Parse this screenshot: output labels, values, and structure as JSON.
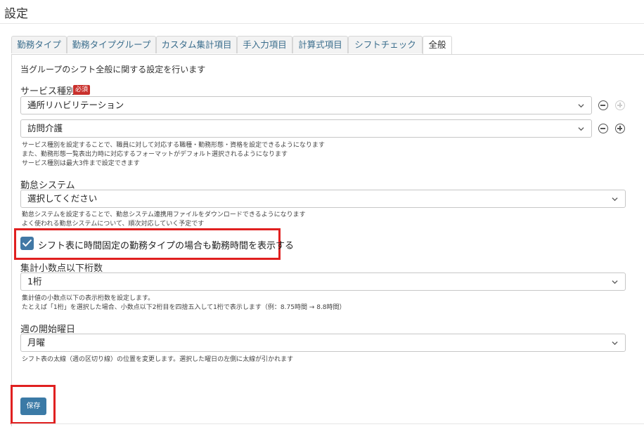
{
  "page": {
    "title": "設定"
  },
  "tabs": [
    {
      "label": "勤務タイプ",
      "active": false
    },
    {
      "label": "勤務タイプグループ",
      "active": false
    },
    {
      "label": "カスタム集計項目",
      "active": false
    },
    {
      "label": "手入力項目",
      "active": false
    },
    {
      "label": "計算式項目",
      "active": false
    },
    {
      "label": "シフトチェック",
      "active": false
    },
    {
      "label": "全般",
      "active": true
    }
  ],
  "panel": {
    "description": "当グループのシフト全般に関する設定を行います"
  },
  "service_type": {
    "label": "サービス種別",
    "required_badge": "必須",
    "selects": [
      {
        "value": "通所リハビリテーション"
      },
      {
        "value": "訪問介護"
      }
    ],
    "notes": [
      "サービス種別を設定することで、職員に対して対応する職種・勤務形態・資格を設定できるようになります",
      "また、勤務形態一覧表出力時に対応するフォーマットがデフォルト選択されるようになります",
      "サービス種別は最大3件まで設定できます"
    ]
  },
  "attendance_system": {
    "label": "勤怠システム",
    "value": "選択してください",
    "notes": [
      "勤怠システムを設定することで、勤怠システム連携用ファイルをダウンロードできるようになります",
      "よく使われる勤怠システムについて、順次対応していく予定です"
    ]
  },
  "show_work_time": {
    "label": "シフト表に時間固定の勤務タイプの場合も勤務時間を表示する",
    "checked": true
  },
  "decimal_places": {
    "label": "集計小数点以下桁数",
    "value": "1桁",
    "notes": [
      "集計値の小数点以下の表示桁数を設定します。",
      "たとえば「1桁」を選択した場合、小数点以下2桁目を四捨五入して1桁で表示します（例：8.75時間 → 8.8時間）"
    ]
  },
  "week_start": {
    "label": "週の開始曜日",
    "value": "月曜",
    "note": "シフト表の太線（週の区切り線）の位置を変更します。選択した曜日の左側に太線が引かれます"
  },
  "save_button": {
    "label": "保存"
  },
  "colors": {
    "accent": "#3b7aa6",
    "checkbox": "#4178a5",
    "highlight": "#e02020",
    "required": "#c9302c",
    "tab_text": "#3a6d8c"
  }
}
